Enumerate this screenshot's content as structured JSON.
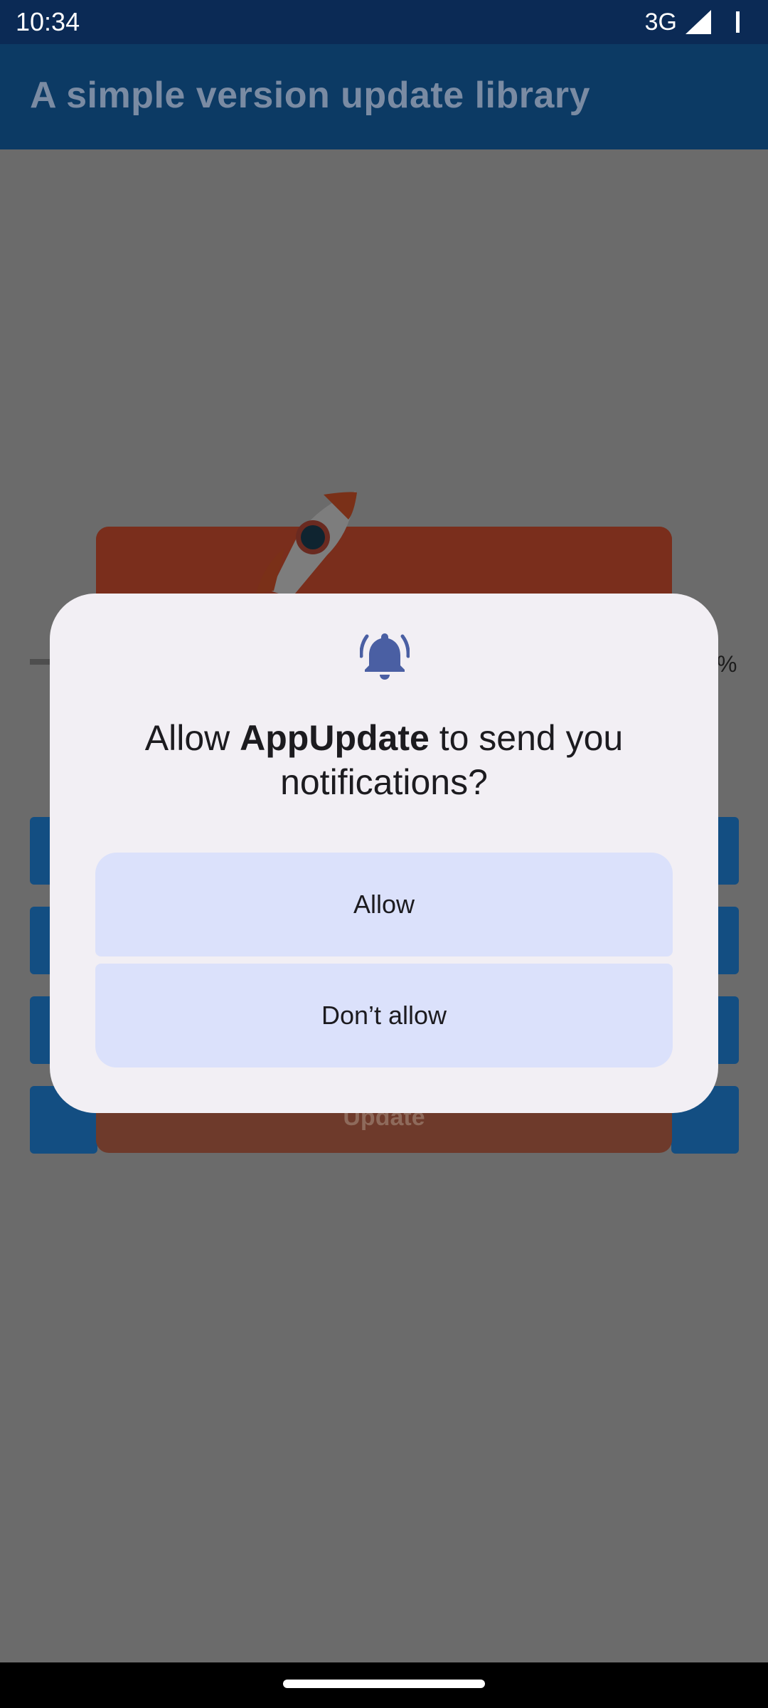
{
  "status_bar": {
    "time": "10:34",
    "network": "3G",
    "icons": [
      "signal-icon",
      "battery-icon"
    ]
  },
  "app_bar": {
    "title": "A simple version update library"
  },
  "background": {
    "progress_percent_label": "%",
    "update_button_label": "Update",
    "icons": [
      "rocket-icon"
    ]
  },
  "dialog": {
    "icon": "bell-icon",
    "title_prefix": "Allow ",
    "app_name": "AppUpdate",
    "title_suffix": " to send you notifications?",
    "allow_label": "Allow",
    "deny_label": "Don’t allow"
  },
  "colors": {
    "status_bar": "#0b2a55",
    "app_bar": "#0c3a64",
    "scrim": "#6b6b6b",
    "dialog_bg": "#f2eff4",
    "dialog_button": "#dbe1fb",
    "bell": "#4a5fa3"
  }
}
